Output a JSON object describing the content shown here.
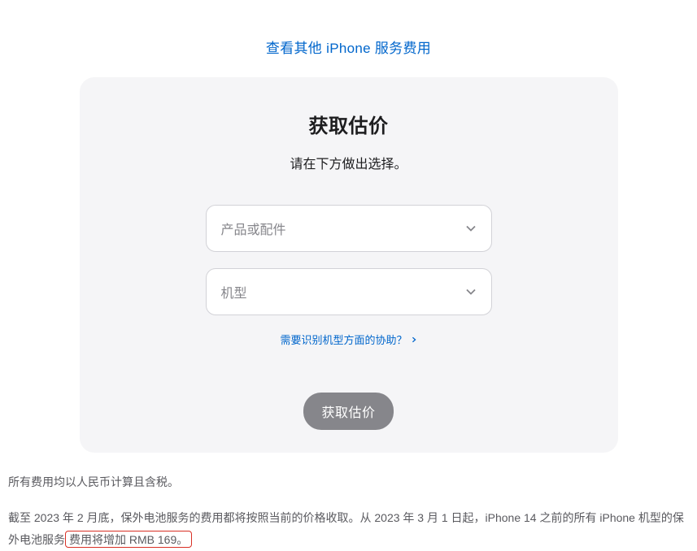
{
  "topLink": {
    "label": "查看其他 iPhone 服务费用"
  },
  "card": {
    "title": "获取估价",
    "subtitle": "请在下方做出选择。",
    "select1": {
      "placeholder": "产品或配件"
    },
    "select2": {
      "placeholder": "机型"
    },
    "helpLink": {
      "label": "需要识别机型方面的协助？"
    },
    "button": {
      "label": "获取估价"
    }
  },
  "footer": {
    "line1": "所有费用均以人民币计算且含税。",
    "line2_part1": "截至 2023 年 2 月底，保外电池服务的费用都将按照当前的价格收取。从 2023 年 3 月 1 日起，iPhone 14 之前的所有 iPhone 机型的保外电池服务",
    "line2_highlight": "费用将增加 RMB 169。"
  }
}
